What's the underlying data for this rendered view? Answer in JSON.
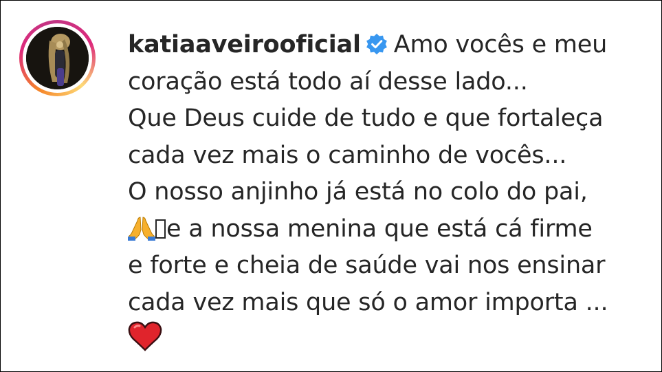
{
  "post_comment": {
    "username": "katiaaveirooficial",
    "verified_icon": "verified-badge-icon",
    "lines": [
      "Amo vocês e meu",
      "coração está todo aí desse lado...",
      "Que Deus cuide de tudo e que fortaleça",
      "cada vez mais o caminho de vocês...",
      "O nosso anjinho já está no colo do pai,",
      "e a nossa menina que está cá firme",
      "e forte e cheia de saúde vai nos ensinar",
      "cada vez mais que só o amor importa ..."
    ],
    "emoji_icons": [
      "praying-hands-icon",
      "red-heart-icon"
    ]
  },
  "colors": {
    "text": "#262626",
    "verified_blue": "#3897f0",
    "story_ring": "#dd2a7b",
    "heart_red": "#e0242c"
  }
}
